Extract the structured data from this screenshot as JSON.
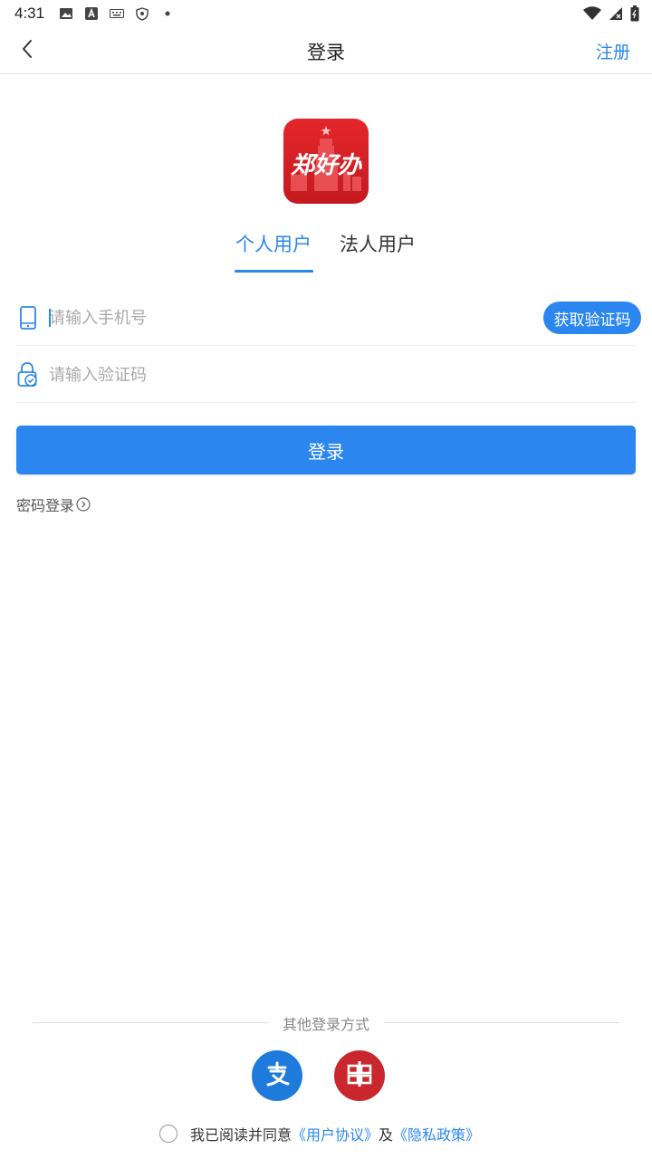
{
  "status_bar": {
    "time": "4:31",
    "icons": [
      "image-icon",
      "a-letter-icon",
      "keyboard-icon",
      "shield-icon",
      "dot-icon"
    ],
    "right_icons": [
      "wifi-icon",
      "signal-icon",
      "battery-icon"
    ]
  },
  "header": {
    "title": "登录",
    "register_label": "注册"
  },
  "logo": {
    "text": "郑好办"
  },
  "tabs": [
    {
      "label": "个人用户",
      "active": true
    },
    {
      "label": "法人用户",
      "active": false
    }
  ],
  "form": {
    "phone_placeholder": "请输入手机号",
    "code_placeholder": "请输入验证码",
    "get_code_label": "获取验证码",
    "login_label": "登录",
    "password_login_label": "密码登录"
  },
  "other_login": {
    "label": "其他登录方式",
    "methods": [
      "alipay-icon",
      "bank-icon"
    ]
  },
  "agreement": {
    "prefix": "我已阅读并同意",
    "user_agreement": "《用户协议》",
    "and": "及",
    "privacy_policy": "《隐私政策》"
  },
  "colors": {
    "accent": "#2b87ef",
    "brand_red": "#d32027",
    "alipay_blue": "#1e7bdb",
    "bank_red": "#c9272d"
  }
}
